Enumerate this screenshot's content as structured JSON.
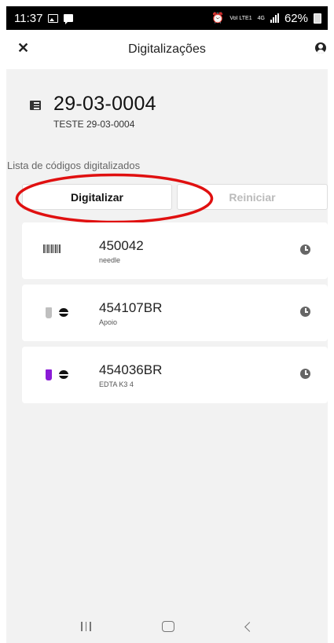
{
  "status_bar": {
    "time": "11:37",
    "net_small": "VoI LTE1",
    "net_small_bottom": "",
    "net_type": "4G",
    "battery": "62%"
  },
  "header": {
    "title": "Digitalizações"
  },
  "order": {
    "number": "29-03-0004",
    "subtitle": "TESTE 29-03-0004"
  },
  "section_label": "Lista de códigos digitalizados",
  "buttons": {
    "scan": "Digitalizar",
    "reset": "Reiniciar"
  },
  "items": [
    {
      "code": "450042",
      "desc": "needle",
      "icon": "barcode-icon"
    },
    {
      "code": "454107BR",
      "desc": "Apoio",
      "icon": "tube-icon",
      "tube_color": "#bfbfbf"
    },
    {
      "code": "454036BR",
      "desc": "EDTA K3 4",
      "icon": "tube-icon",
      "tube_color": "#8a1bd6"
    }
  ],
  "annotation_color": "#e01010"
}
